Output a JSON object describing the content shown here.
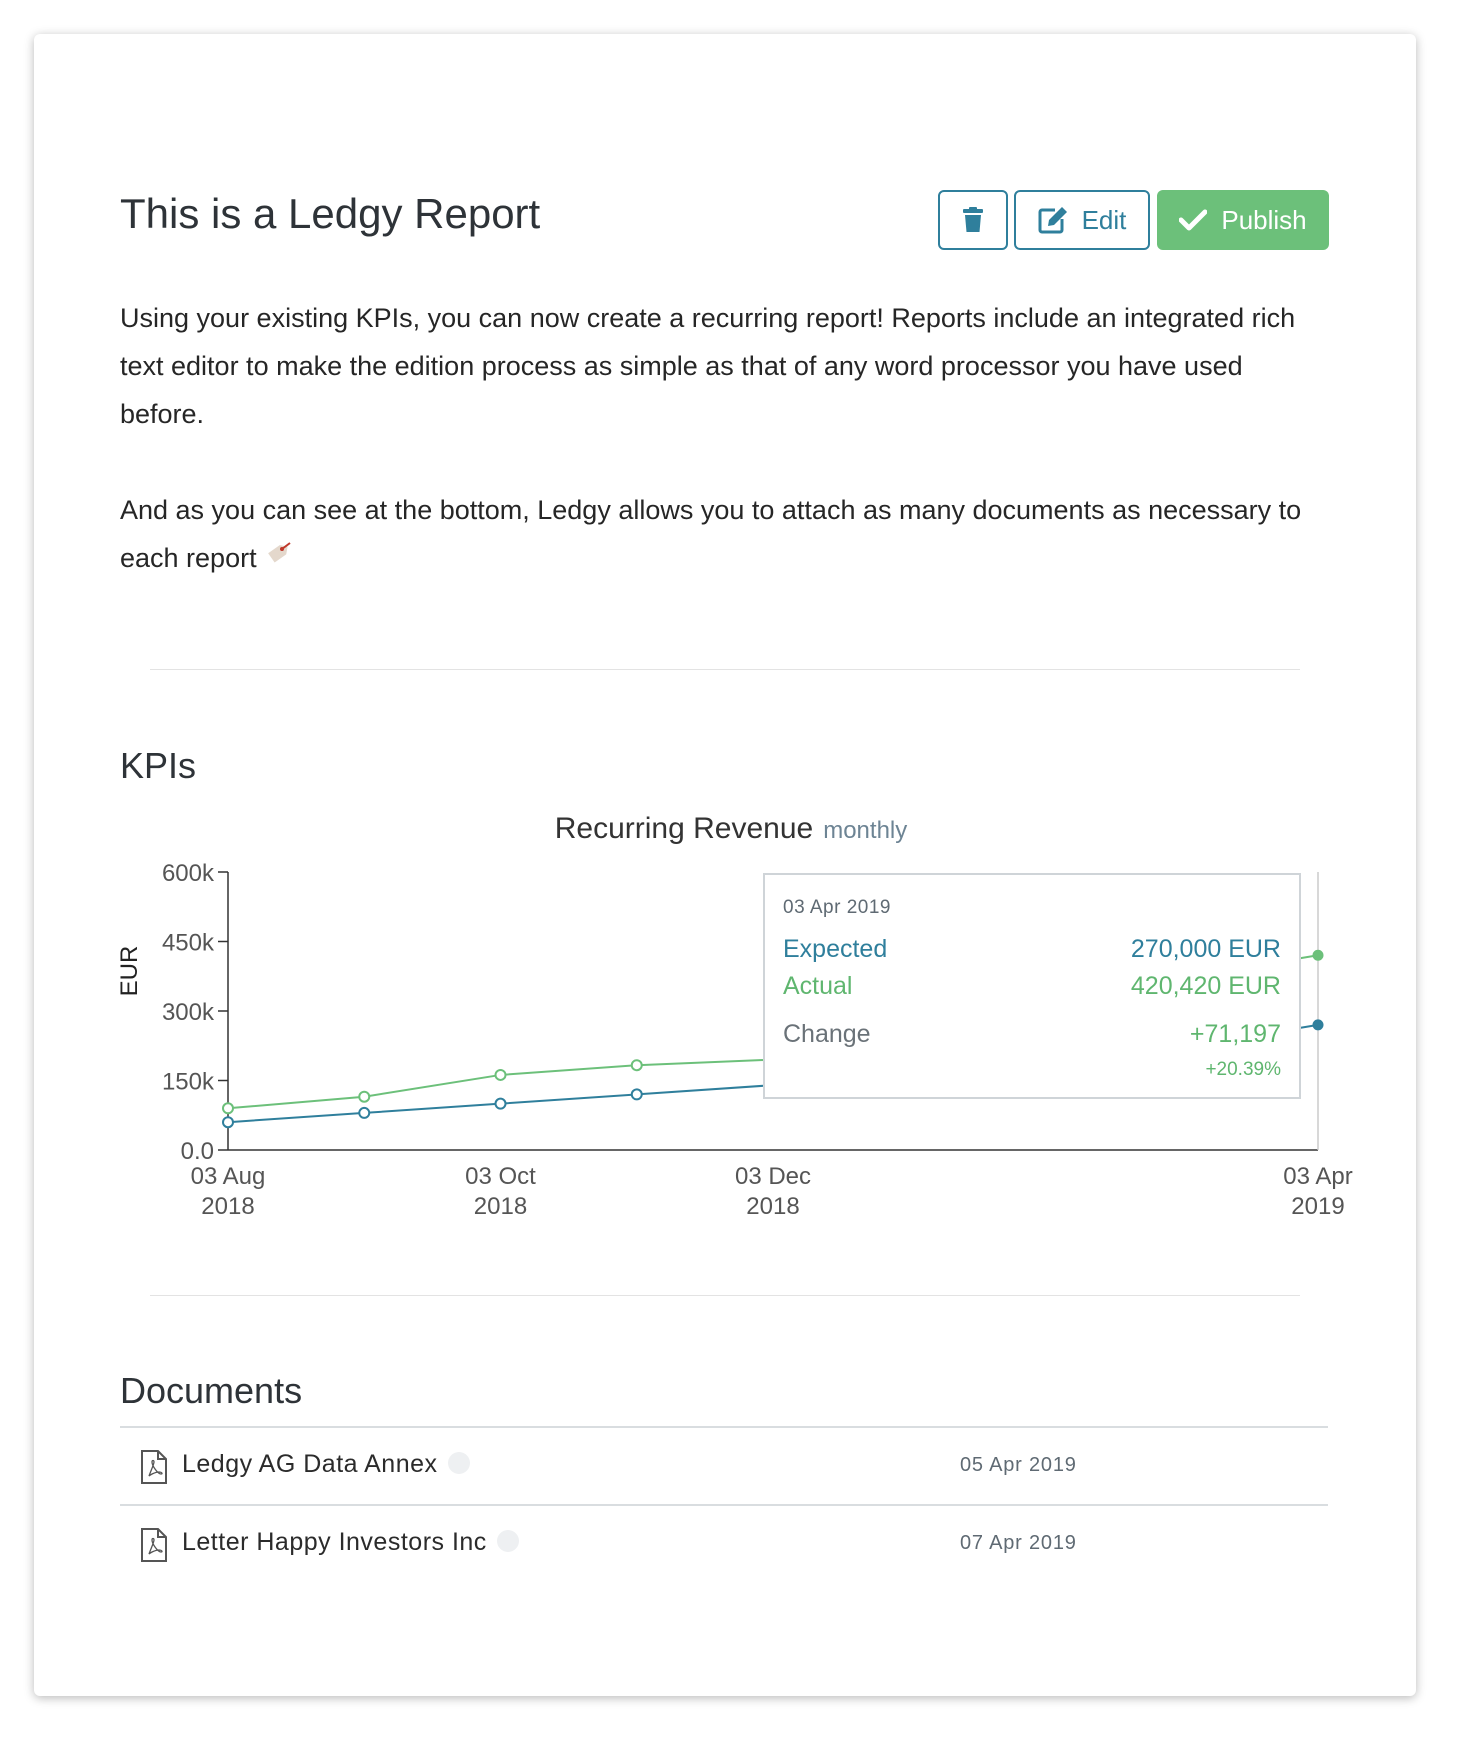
{
  "report": {
    "title": "This is a Ledgy Report",
    "paragraph1": "Using your existing KPIs, you can now create a recurring report! Reports include an integrated rich text editor to make the edition process as simple as that of any word processor you have used before.",
    "paragraph2": "And as you can see at the bottom, Ledgy allows you to attach as many documents as necessary to each report",
    "paragraph2_emoji": "label-emoji"
  },
  "toolbar": {
    "delete_icon": "trash-icon",
    "edit_label": "Edit",
    "edit_icon": "edit-icon",
    "publish_label": "Publish",
    "publish_icon": "check-icon",
    "accent_color": "#2f7f9c",
    "publish_color": "#6cc07a"
  },
  "kpis": {
    "title": "KPIs",
    "chart_title": "Recurring Revenue",
    "chart_subtitle": "monthly"
  },
  "chart_data": {
    "type": "line",
    "title": "Recurring Revenue",
    "subtitle": "monthly",
    "ylabel": "EUR",
    "xlabel": "",
    "ylim": [
      0,
      600000
    ],
    "y_ticks": [
      {
        "value": 0,
        "label": "0.0"
      },
      {
        "value": 150000,
        "label": "150k"
      },
      {
        "value": 300000,
        "label": "300k"
      },
      {
        "value": 450000,
        "label": "450k"
      },
      {
        "value": 600000,
        "label": "600k"
      }
    ],
    "x_ticks": [
      {
        "index": 0,
        "line1": "03 Aug",
        "line2": "2018"
      },
      {
        "index": 2,
        "line1": "03 Oct",
        "line2": "2018"
      },
      {
        "index": 4,
        "line1": "03 Dec",
        "line2": "2018"
      },
      {
        "index": 8,
        "line1": "03 Apr",
        "line2": "2019"
      }
    ],
    "n_points": 9,
    "series": [
      {
        "name": "Expected",
        "color": "#2f7f9c",
        "values": [
          60000,
          80000,
          100000,
          120000,
          140000,
          null,
          null,
          null,
          270000
        ]
      },
      {
        "name": "Actual",
        "color": "#6cc07a",
        "values": [
          90000,
          115000,
          162000,
          183000,
          195000,
          null,
          null,
          null,
          420420
        ]
      }
    ],
    "grid": false,
    "legend": "none",
    "tooltip": {
      "date": "03 Apr 2019",
      "expected_label": "Expected",
      "expected_value": "270,000 EUR",
      "actual_label": "Actual",
      "actual_value": "420,420 EUR",
      "change_label": "Change",
      "change_value": "+71,197",
      "change_percent": "+20.39%"
    }
  },
  "documents": {
    "title": "Documents",
    "items": [
      {
        "name": "Ledgy AG Data Annex",
        "date": "05 Apr 2019",
        "icon": "pdf-file-icon"
      },
      {
        "name": "Letter Happy Investors Inc",
        "date": "07 Apr 2019",
        "icon": "pdf-file-icon"
      }
    ]
  }
}
